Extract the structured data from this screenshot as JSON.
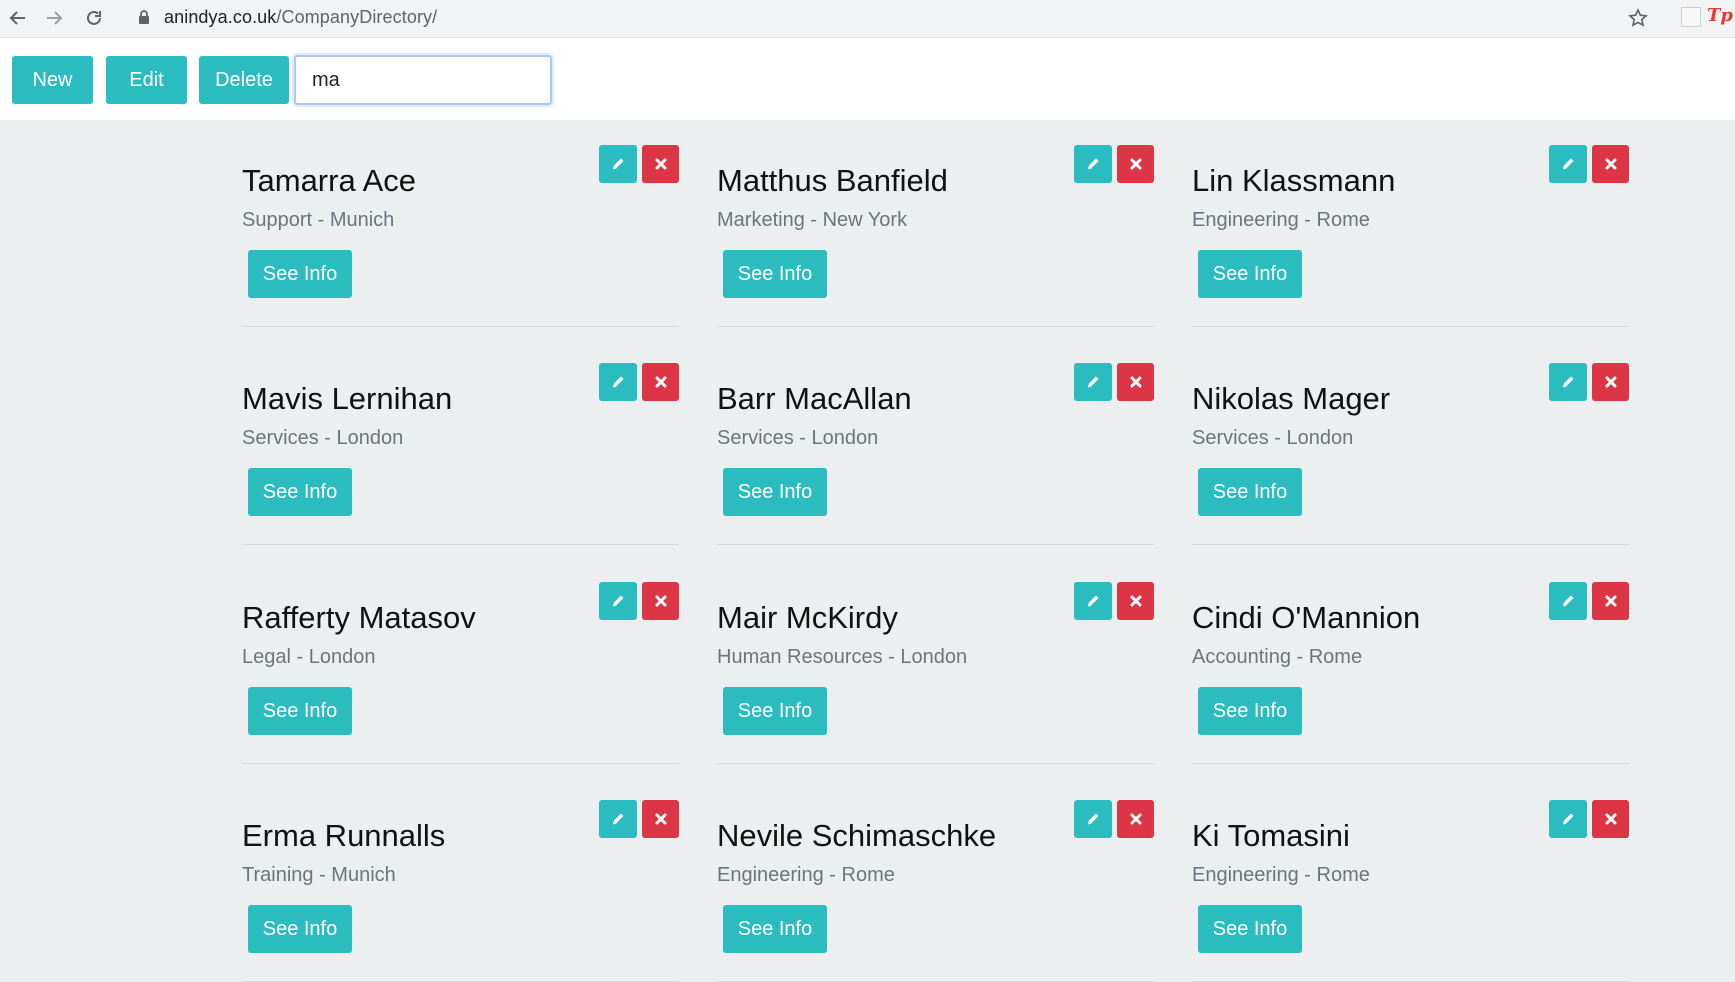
{
  "browser": {
    "url_host": "anindya.co.uk",
    "url_path": "/CompanyDirectory/",
    "icons": [
      "back-arrow-icon",
      "forward-arrow-icon",
      "reload-icon",
      "lock-icon",
      "star-icon",
      "extension-icon",
      "tp-extension-icon"
    ],
    "ext_label": "Tp"
  },
  "toolbar": {
    "new_label": "New",
    "edit_label": "Edit",
    "delete_label": "Delete",
    "search_value": "ma"
  },
  "colors": {
    "accent": "#2bbcbf",
    "danger": "#dc3545",
    "background": "#eceff0"
  },
  "employees": [
    {
      "name": "Tamarra Ace",
      "meta": "Support - Munich",
      "button": "See Info"
    },
    {
      "name": "Matthus Banfield",
      "meta": "Marketing - New York",
      "button": "See Info"
    },
    {
      "name": "Lin Klassmann",
      "meta": "Engineering - Rome",
      "button": "See Info"
    },
    {
      "name": "Mavis Lernihan",
      "meta": "Services - London",
      "button": "See Info"
    },
    {
      "name": "Barr MacAllan",
      "meta": "Services - London",
      "button": "See Info"
    },
    {
      "name": "Nikolas Mager",
      "meta": "Services - London",
      "button": "See Info"
    },
    {
      "name": "Rafferty Matasov",
      "meta": "Legal - London",
      "button": "See Info"
    },
    {
      "name": "Mair McKirdy",
      "meta": "Human Resources - London",
      "button": "See Info"
    },
    {
      "name": "Cindi O'Mannion",
      "meta": "Accounting - Rome",
      "button": "See Info"
    },
    {
      "name": "Erma Runnalls",
      "meta": "Training - Munich",
      "button": "See Info"
    },
    {
      "name": "Nevile Schimaschke",
      "meta": "Engineering - Rome",
      "button": "See Info"
    },
    {
      "name": "Ki Tomasini",
      "meta": "Engineering - Rome",
      "button": "See Info"
    }
  ]
}
